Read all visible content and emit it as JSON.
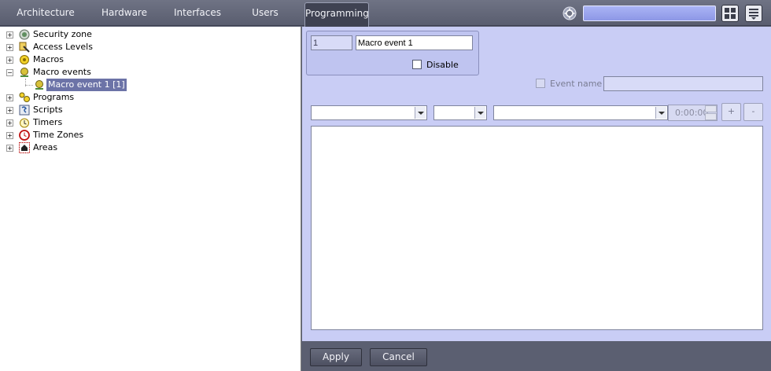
{
  "top_nav": {
    "tabs": [
      {
        "label": "Architecture"
      },
      {
        "label": "Hardware"
      },
      {
        "label": "Interfaces"
      },
      {
        "label": "Users"
      },
      {
        "label": "Programming"
      }
    ],
    "active_tab": "Programming",
    "search": {
      "value": ""
    }
  },
  "tree": {
    "items": [
      {
        "label": "Security zone",
        "icon": "security-zone-icon",
        "expander": "+"
      },
      {
        "label": "Access Levels",
        "icon": "access-levels-icon",
        "expander": "+"
      },
      {
        "label": "Macros",
        "icon": "macros-icon",
        "expander": "+"
      },
      {
        "label": "Macro events",
        "icon": "macro-events-icon",
        "expander": "−"
      },
      {
        "label": "Macro event 1 [1]",
        "icon": "macro-event-icon",
        "selected": true
      },
      {
        "label": "Programs",
        "icon": "programs-icon",
        "expander": "+"
      },
      {
        "label": "Scripts",
        "icon": "scripts-icon",
        "expander": "+"
      },
      {
        "label": "Timers",
        "icon": "timers-icon",
        "expander": "+"
      },
      {
        "label": "Time Zones",
        "icon": "time-zones-icon",
        "expander": "+"
      },
      {
        "label": "Areas",
        "icon": "areas-icon",
        "expander": "+"
      }
    ]
  },
  "form": {
    "id_value": "1",
    "name_value": "Macro event 1",
    "disable_label": "Disable",
    "event_name_label": "Event name",
    "event_name_value": "",
    "time_value": "0:00:00",
    "add_label": "+",
    "remove_label": "-"
  },
  "footer": {
    "apply_label": "Apply",
    "cancel_label": "Cancel"
  },
  "colors": {
    "panel_bg": "#c9cdf5",
    "top_bar": "#5b5f71",
    "selection": "#6c73a7"
  }
}
